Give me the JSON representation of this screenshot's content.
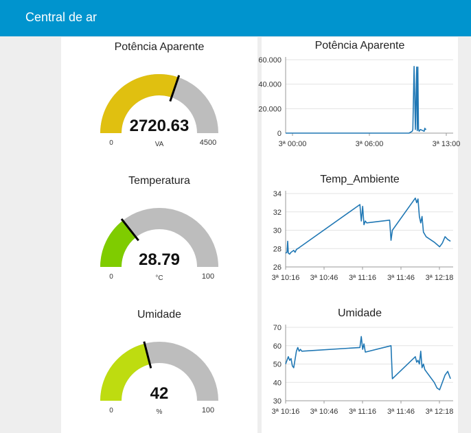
{
  "header": {
    "title": "Central de ar"
  },
  "gauges": [
    {
      "title": "Potência Aparente",
      "value": 2720.63,
      "value_label": "2720.63",
      "unit": "VA",
      "min": 0,
      "max": 4500,
      "min_label": "0",
      "max_label": "4500",
      "color": "#e0c010"
    },
    {
      "title": "Temperatura",
      "value": 28.79,
      "value_label": "28.79",
      "unit": "°C",
      "min": 0,
      "max": 100,
      "min_label": "0",
      "max_label": "100",
      "color": "#7fcc00"
    },
    {
      "title": "Umidade",
      "value": 42,
      "value_label": "42",
      "unit": "%",
      "min": 0,
      "max": 100,
      "min_label": "0",
      "max_label": "100",
      "color": "#bedc10"
    }
  ],
  "chart_data": [
    {
      "type": "line",
      "title": "Potência Aparente",
      "xlabel": "",
      "ylabel": "",
      "x_ticks": [
        "3ª 00:00",
        "3ª 06:00",
        "3ª 13:00"
      ],
      "y_ticks": [
        "0",
        "20.000",
        "40.000",
        "60.000"
      ],
      "xlim": [
        0,
        13.3
      ],
      "ylim": [
        0,
        60000
      ],
      "grid": true,
      "color": "#1f77b4",
      "series": [
        {
          "x": [
            0.0,
            3.0,
            6.0,
            9.0,
            9.8,
            10.05,
            10.1,
            10.2,
            10.3,
            10.4,
            10.45,
            10.5,
            10.55,
            10.6,
            10.7,
            11.0,
            11.05,
            11.1,
            11.15
          ],
          "values": [
            0,
            0,
            0,
            0,
            0,
            1500,
            3000,
            54500,
            3000,
            54000,
            2000,
            54000,
            3000,
            1500,
            3000,
            1500,
            4000,
            3000,
            3500
          ]
        }
      ]
    },
    {
      "type": "line",
      "title": "Temp_Ambiente",
      "xlabel": "",
      "ylabel": "",
      "x_ticks": [
        "3ª 10:16",
        "3ª 10:46",
        "3ª 11:16",
        "3ª 11:46",
        "3ª 12:18"
      ],
      "y_ticks": [
        "26",
        "28",
        "30",
        "32",
        "34"
      ],
      "xlim": [
        0,
        124
      ],
      "ylim": [
        26,
        34
      ],
      "grid": true,
      "color": "#1f77b4",
      "series": [
        {
          "x": [
            0,
            1,
            1.5,
            2,
            3,
            4,
            6,
            7,
            8,
            10,
            55,
            56,
            57,
            58,
            59,
            60,
            77,
            78,
            79,
            96,
            97,
            98,
            99,
            100,
            101,
            102,
            104,
            110,
            114,
            116,
            118,
            120,
            122
          ],
          "values": [
            27.5,
            27.6,
            28.8,
            27.5,
            27.4,
            27.6,
            27.8,
            27.6,
            27.9,
            28.1,
            32.8,
            31.0,
            32.6,
            30.6,
            31.0,
            30.8,
            31.1,
            28.9,
            30.0,
            33.5,
            33.0,
            33.4,
            31.5,
            30.8,
            31.5,
            29.8,
            29.3,
            28.7,
            28.2,
            28.6,
            29.3,
            29.0,
            28.8
          ]
        }
      ]
    },
    {
      "type": "line",
      "title": "Umidade",
      "xlabel": "",
      "ylabel": "",
      "x_ticks": [
        "3ª 10:16",
        "3ª 10:46",
        "3ª 11:16",
        "3ª 11:46",
        "3ª 12:18"
      ],
      "y_ticks": [
        "30",
        "40",
        "50",
        "60",
        "70"
      ],
      "xlim": [
        0,
        124
      ],
      "ylim": [
        30,
        70
      ],
      "grid": true,
      "color": "#1f77b4",
      "series": [
        {
          "x": [
            0,
            2,
            3,
            4,
            5,
            6,
            8,
            9,
            10,
            11,
            12,
            55,
            56,
            57,
            58,
            59,
            78,
            79,
            96,
            97,
            98,
            99,
            100,
            101,
            102,
            103,
            104,
            106,
            110,
            112,
            114,
            118,
            120,
            122
          ],
          "values": [
            50,
            54,
            52,
            53,
            49,
            48,
            57,
            59,
            57,
            58,
            57,
            59,
            65,
            58,
            61,
            56.5,
            60,
            42,
            54,
            51,
            52,
            50,
            57,
            48,
            50,
            47,
            46,
            44,
            40,
            37,
            36,
            44,
            46,
            42
          ]
        }
      ]
    }
  ]
}
